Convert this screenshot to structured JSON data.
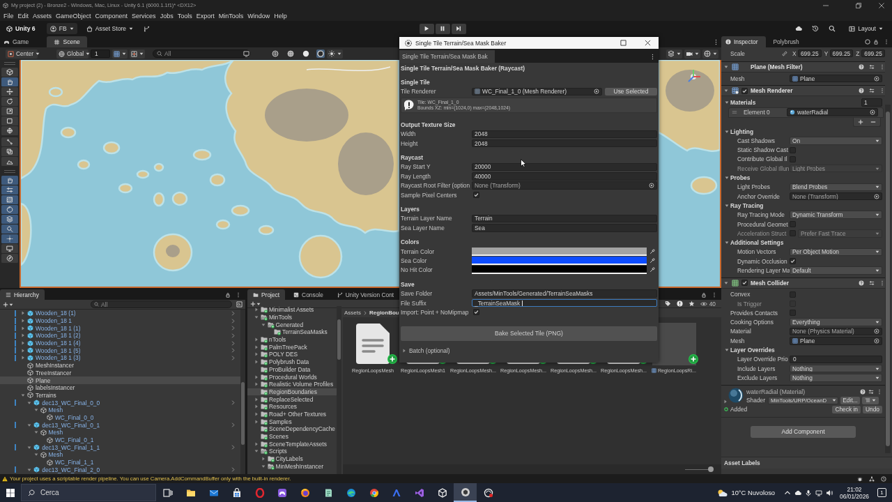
{
  "window": {
    "title": "My project (2) - Bronze2 - Windows, Mac, Linux - Unity 6.1 (6000.1.1f1)* <DX12>"
  },
  "menu": [
    "File",
    "Edit",
    "Assets",
    "GameObject",
    "Component",
    "Services",
    "Jobs",
    "Tools",
    "Export",
    "MinTools",
    "Window",
    "Help"
  ],
  "toolbar": {
    "items": [
      {
        "kind": "unity",
        "label": "Unity 6"
      },
      {
        "kind": "account",
        "label": "FB"
      },
      {
        "kind": "store",
        "label": "Asset Store"
      }
    ],
    "layout": "Layout"
  },
  "scene_panel": {
    "tabs": [
      {
        "label": "Game",
        "kind": "game",
        "selected": false
      },
      {
        "label": "Scene",
        "kind": "scene",
        "selected": true
      }
    ],
    "pivot": "Center",
    "space": "Global",
    "snap": "1",
    "search": {
      "placeholder": "All"
    },
    "tool_groups": [
      {
        "kind": "panel",
        "tools": [
          {
            "kind": "cube",
            "selected": false
          },
          {
            "kind": "hand",
            "selected": true
          },
          {
            "kind": "move",
            "selected": false
          },
          {
            "kind": "rotate",
            "selected": false
          },
          {
            "kind": "scale",
            "selected": false
          },
          {
            "kind": "rect",
            "selected": false
          },
          {
            "kind": "transform",
            "selected": false
          }
        ]
      },
      {
        "kind": "strip",
        "tools": [
          {
            "kind": "nodes",
            "selected": false
          },
          {
            "kind": "copy",
            "selected": false
          },
          {
            "kind": "terrain",
            "selected": false
          }
        ]
      },
      {
        "kind": "panel",
        "tools": [
          {
            "kind": "hand",
            "selected": true
          },
          {
            "kind": "sliders",
            "selected": true
          },
          {
            "kind": "hatch",
            "selected": true
          },
          {
            "kind": "sphere",
            "selected": true
          },
          {
            "kind": "layers",
            "selected": true
          },
          {
            "kind": "magnifier",
            "selected": true
          },
          {
            "kind": "dots",
            "selected": true
          },
          {
            "kind": "monitor",
            "selected": false
          },
          {
            "kind": "compass",
            "selected": false
          }
        ]
      }
    ]
  },
  "hierarchy": {
    "title": "Hierarchy",
    "search": {
      "placeholder": "All"
    },
    "items": [
      {
        "label": "Wooden_18 (1)",
        "kind": "prefab",
        "expanded": false,
        "selected": false
      },
      {
        "label": "Wooden_18 1",
        "kind": "prefab",
        "expanded": false,
        "selected": false
      },
      {
        "label": "Wooden_18 1 (1)",
        "kind": "prefab",
        "expanded": false,
        "selected": false
      },
      {
        "label": "Wooden_18 1 (2)",
        "kind": "prefab",
        "expanded": false,
        "selected": false
      },
      {
        "label": "Wooden_18 1 (4)",
        "kind": "prefab",
        "expanded": false,
        "selected": false
      },
      {
        "label": "Wooden_18 1 (5)",
        "kind": "prefab",
        "expanded": false,
        "selected": false
      },
      {
        "label": "Wooden_18 1 (3)",
        "kind": "prefab",
        "expanded": false,
        "selected": false
      },
      {
        "label": "MeshInstancer",
        "kind": "object",
        "selected": false
      },
      {
        "label": "TreeInstancer",
        "kind": "object",
        "selected": false
      },
      {
        "label": "Plane",
        "kind": "object",
        "selected": true
      },
      {
        "label": "labelsInstancer",
        "kind": "object",
        "selected": false
      },
      {
        "label": "Terrains",
        "kind": "object",
        "expanded": true,
        "selected": false,
        "children": [
          {
            "label": "dec13_WC_Final_0_0",
            "kind": "prefab",
            "expanded": true,
            "selected": false,
            "children": [
              {
                "label": "Mesh",
                "kind": "prefab_part",
                "expanded": true,
                "selected": false,
                "children": [
                  {
                    "label": "WC_Final_0_0",
                    "kind": "prefab_part",
                    "selected": false
                  }
                ]
              }
            ]
          },
          {
            "label": "dec13_WC_Final_0_1",
            "kind": "prefab",
            "expanded": true,
            "selected": false,
            "children": [
              {
                "label": "Mesh",
                "kind": "prefab_part",
                "expanded": true,
                "selected": false,
                "children": [
                  {
                    "label": "WC_Final_0_1",
                    "kind": "prefab_part",
                    "selected": false
                  }
                ]
              }
            ]
          },
          {
            "label": "dec13_WC_Final_1_1",
            "kind": "prefab",
            "expanded": true,
            "selected": false,
            "children": [
              {
                "label": "Mesh",
                "kind": "prefab_part",
                "expanded": true,
                "selected": false,
                "children": [
                  {
                    "label": "WC_Final_1_1",
                    "kind": "prefab_part",
                    "selected": false
                  }
                ]
              }
            ]
          },
          {
            "label": "dec13_WC_Final_2_0",
            "kind": "prefab",
            "expanded": true,
            "selected": false
          }
        ]
      }
    ]
  },
  "project": {
    "tabs": [
      {
        "label": "Project",
        "kind": "project",
        "selected": true
      },
      {
        "label": "Console",
        "kind": "console",
        "selected": false
      },
      {
        "label": "Unity Version Cont",
        "kind": "version",
        "selected": false
      }
    ],
    "folders": [
      {
        "label": "Minimalist Assets",
        "expanded": false,
        "selected": false,
        "added": true
      },
      {
        "label": "MinTools",
        "expanded": true,
        "selected": false,
        "added": true,
        "children": [
          {
            "label": "Generated",
            "expanded": true,
            "selected": false,
            "added": true,
            "children": [
              {
                "label": "TerrainSeaMasks",
                "selected": false,
                "added": true
              }
            ]
          }
        ]
      },
      {
        "label": "nTools",
        "expanded": false,
        "selected": false,
        "added": true
      },
      {
        "label": "PalmTreePack",
        "expanded": false,
        "selected": false,
        "added": true
      },
      {
        "label": "POLY DES",
        "expanded": false,
        "selected": false,
        "added": true
      },
      {
        "label": "Polybrush Data",
        "expanded": false,
        "selected": false,
        "added": true
      },
      {
        "label": "ProBuilder Data",
        "selected": false,
        "added": true
      },
      {
        "label": "Procedural Worlds",
        "expanded": false,
        "selected": false,
        "added": true
      },
      {
        "label": "Realistic Volume Profiles",
        "expanded": false,
        "selected": false,
        "added": true
      },
      {
        "label": "RegionBoundaries",
        "selected": true,
        "added": true
      },
      {
        "label": "ReplaceSelected",
        "expanded": false,
        "selected": false,
        "added": true
      },
      {
        "label": "Resources",
        "expanded": false,
        "selected": false,
        "added": true
      },
      {
        "label": "Road+ Other Textures",
        "expanded": false,
        "selected": false,
        "added": true
      },
      {
        "label": "Samples",
        "expanded": false,
        "selected": false,
        "added": true
      },
      {
        "label": "SceneDependencyCache",
        "selected": false,
        "added": true
      },
      {
        "label": "Scenes",
        "selected": false,
        "added": true
      },
      {
        "label": "SceneTemplateAssets",
        "expanded": false,
        "selected": false,
        "added": true
      },
      {
        "label": "Scripts",
        "expanded": true,
        "selected": false,
        "added": true,
        "children": [
          {
            "label": "CityLabels",
            "expanded": false,
            "selected": false,
            "added": true
          },
          {
            "label": "MinMeshInstancer",
            "expanded": true,
            "selected": false,
            "added": true
          }
        ]
      }
    ],
    "breadcrumb": [
      "Assets",
      "RegionBou"
    ],
    "count": "40",
    "assets": [
      {
        "label": "RegionLoopsMesh",
        "kind": "file",
        "added": true
      },
      {
        "label": "RegionLoopsMesh1",
        "kind": "file",
        "added": true
      },
      {
        "label": "RegionLoopsMesh...",
        "kind": "file",
        "added": true
      },
      {
        "label": "RegionLoopsMesh...",
        "kind": "file",
        "added": true
      },
      {
        "label": "RegionLoopsMesh...",
        "kind": "file",
        "added": true
      },
      {
        "label": "RegionLoopsMesh...",
        "kind": "file",
        "added": true
      },
      {
        "label": "RegionLoopsRi...",
        "kind": "mesh",
        "added": true
      }
    ],
    "icon_size": {
      "level": 0.92
    }
  },
  "inspector": {
    "tabs": [
      {
        "label": "Inspector",
        "kind": "info",
        "selected": true
      },
      {
        "label": "Polybrush",
        "kind": "plain",
        "selected": false
      }
    ],
    "transform": {
      "label": "Scale",
      "axes": [
        {
          "axis": "X",
          "value": "699.25"
        },
        {
          "axis": "Y",
          "value": "699.25"
        },
        {
          "axis": "Z",
          "value": "699.25"
        }
      ]
    },
    "components": [
      {
        "kind": "mesh_filter",
        "title": "Plane (Mesh Filter)",
        "expanded": true,
        "rows": [
          {
            "kind": "object",
            "label": "Mesh",
            "value": "Plane",
            "assigned": true
          }
        ]
      },
      {
        "kind": "mesh_renderer",
        "title": "Mesh Renderer",
        "expanded": true,
        "enabled": true,
        "rows": [
          {
            "kind": "foldout",
            "label": "Materials",
            "expanded": true,
            "count": "1",
            "children": [
              {
                "kind": "element",
                "label": "Element 0",
                "value": "waterRadial"
              },
              {
                "kind": "add_remove"
              }
            ]
          },
          {
            "kind": "foldout",
            "label": "Lighting",
            "expanded": true,
            "children": [
              {
                "kind": "dropdown",
                "label": "Cast Shadows",
                "value": "On",
                "disabled": false
              },
              {
                "kind": "checkbox",
                "label": "Static Shadow Cast",
                "checked": false,
                "disabled": false
              },
              {
                "kind": "checkbox",
                "label": "Contribute Global Il",
                "checked": false,
                "disabled": false
              },
              {
                "kind": "dropdown",
                "label": "Receive Global Illun",
                "value": "Light Probes",
                "disabled": true
              }
            ]
          },
          {
            "kind": "foldout",
            "label": "Probes",
            "expanded": true,
            "children": [
              {
                "kind": "dropdown",
                "label": "Light Probes",
                "value": "Blend Probes",
                "disabled": false
              },
              {
                "kind": "object",
                "label": "Anchor Override",
                "value": "None (Transform)",
                "assigned": false
              }
            ]
          },
          {
            "kind": "foldout",
            "label": "Ray Tracing",
            "expanded": true,
            "children": [
              {
                "kind": "dropdown",
                "label": "Ray Tracing Mode",
                "value": "Dynamic Transform",
                "disabled": false
              },
              {
                "kind": "checkbox",
                "label": "Procedural Geomet",
                "checked": false,
                "disabled": false
              },
              {
                "kind": "check_dropdown",
                "label": "Acceleration Struct",
                "checked": false,
                "value": "Prefer Fast Trace",
                "disabled": true
              }
            ]
          },
          {
            "kind": "foldout",
            "label": "Additional Settings",
            "expanded": true,
            "children": [
              {
                "kind": "dropdown",
                "label": "Motion Vectors",
                "value": "Per Object Motion",
                "disabled": false
              },
              {
                "kind": "checkbox",
                "label": "Dynamic Occlusion",
                "checked": true,
                "disabled": false
              },
              {
                "kind": "dropdown",
                "label": "Rendering Layer Ma",
                "value": "Default",
                "disabled": false
              }
            ]
          }
        ]
      },
      {
        "kind": "mesh_collider",
        "title": "Mesh Collider",
        "expanded": true,
        "enabled": true,
        "rows": [
          {
            "kind": "checkbox",
            "label": "Convex",
            "checked": false,
            "disabled": false,
            "children": [
              {
                "kind": "checkbox",
                "label": "Is Trigger",
                "checked": false,
                "disabled": true
              }
            ]
          },
          {
            "kind": "checkbox",
            "label": "Provides Contacts",
            "checked": false,
            "disabled": false
          },
          {
            "kind": "dropdown",
            "label": "Cooking Options",
            "value": "Everything",
            "disabled": false
          },
          {
            "kind": "object",
            "label": "Material",
            "value": "None (Physics Material)",
            "assigned": false
          },
          {
            "kind": "object",
            "label": "Mesh",
            "value": "Plane",
            "assigned": true
          },
          {
            "kind": "foldout",
            "label": "Layer Overrides",
            "expanded": true,
            "children": [
              {
                "kind": "number",
                "label": "Layer Override Prio",
                "value": "0"
              },
              {
                "kind": "dropdown",
                "label": "Include Layers",
                "value": "Nothing",
                "disabled": false
              },
              {
                "kind": "dropdown",
                "label": "Exclude Layers",
                "value": "Nothing",
                "disabled": false
              }
            ]
          }
        ]
      }
    ],
    "material": {
      "title": "waterRadial (Material)",
      "shader_label": "Shader",
      "shader": "MinTools/URP/OceanD",
      "edit": "Edit...",
      "status": "Added",
      "actions": [
        "Check in",
        "Undo"
      ]
    },
    "add_component": "Add Component",
    "asset_labels": "Asset Labels"
  },
  "dialog": {
    "title": "Single Tile Terrain/Sea Mask Baker",
    "tab": "Single Tile Terrain/Sea Mask Bak",
    "heading": "Single Tile Terrain/Sea Mask Baker (Raycast)",
    "sections": [
      {
        "title": "Single Tile",
        "rows": [
          {
            "kind": "object",
            "label": "Tile Renderer",
            "value": "WC_Final_1_0 (Mesh Renderer)",
            "assigned": true,
            "button": "Use Selected"
          },
          {
            "kind": "help",
            "lines": [
              "Tile: WC_Final_1_0",
              "Bounds XZ: min=(1024,0) max=(2048,1024)"
            ]
          }
        ]
      },
      {
        "title": "Output Texture Size",
        "rows": [
          {
            "kind": "text",
            "label": "Width",
            "value": "2048",
            "focused": false
          },
          {
            "kind": "text",
            "label": "Height",
            "value": "2048",
            "focused": false
          }
        ]
      },
      {
        "title": "Raycast",
        "rows": [
          {
            "kind": "text",
            "label": "Ray Start Y",
            "value": "20000",
            "focused": false
          },
          {
            "kind": "text",
            "label": "Ray Length",
            "value": "40000",
            "focused": false
          },
          {
            "kind": "object",
            "label": "Raycast Root Filter (option",
            "value": "None (Transform)",
            "assigned": false
          },
          {
            "kind": "checkbox",
            "label": "Sample Pixel Centers",
            "checked": true
          }
        ]
      },
      {
        "title": "Layers",
        "rows": [
          {
            "kind": "text",
            "label": "Terrain Layer Name",
            "value": "Terrain",
            "focused": false
          },
          {
            "kind": "text",
            "label": "Sea Layer Name",
            "value": "Sea",
            "focused": false
          }
        ]
      },
      {
        "title": "Colors",
        "rows": [
          {
            "kind": "color",
            "label": "Terrain Color",
            "color": "#a3a3a3"
          },
          {
            "kind": "color",
            "label": "Sea Color",
            "color": "#0d4cff"
          },
          {
            "kind": "color",
            "label": "No Hit Color",
            "color": "#000000"
          }
        ]
      },
      {
        "title": "Save",
        "rows": [
          {
            "kind": "text",
            "label": "Save Folder",
            "value": "Assets/MinTools/Generated/TerrainSeaMasks",
            "focused": false
          },
          {
            "kind": "text",
            "label": "File Suffix",
            "value": "_TerrainSeaMask",
            "focused": true
          },
          {
            "kind": "checkbox",
            "label": "Import: Point + NoMipmap",
            "checked": true
          }
        ]
      }
    ],
    "action": "Bake Selected Tile (PNG)",
    "batch": {
      "label": "Batch (optional)",
      "expanded": false
    }
  },
  "status_bar": {
    "kind": "warning",
    "message": "Your project uses a scriptable render pipeline. You can use Camera.AddCommandBuffer only with the built-in renderer."
  },
  "taskbar": {
    "search": {
      "placeholder": "Cerca"
    },
    "apps": [
      {
        "kind": "task_view",
        "active": false
      },
      {
        "kind": "explorer",
        "active": false
      },
      {
        "kind": "mail",
        "active": false
      },
      {
        "kind": "store",
        "active": false
      },
      {
        "kind": "ring",
        "active": false
      },
      {
        "kind": "controller",
        "active": false
      },
      {
        "kind": "fox",
        "active": false
      },
      {
        "kind": "notes",
        "active": false
      },
      {
        "kind": "wave",
        "active": false
      },
      {
        "kind": "chrome",
        "active": false
      },
      {
        "kind": "arch",
        "active": false
      },
      {
        "kind": "ribbon",
        "active": false
      },
      {
        "kind": "cube",
        "active": false
      },
      {
        "kind": "hub",
        "active": true
      },
      {
        "kind": "recorder",
        "active": false
      }
    ],
    "weather": "10°C Nuvoloso",
    "time": "21:02",
    "date": "06/01/2026",
    "notifications": "1"
  }
}
